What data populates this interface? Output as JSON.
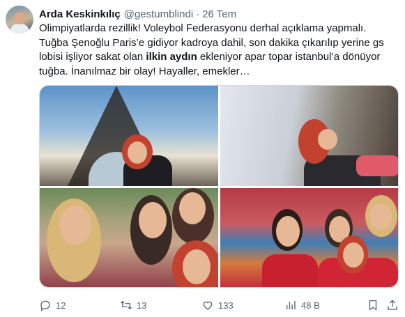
{
  "tweet": {
    "author_name": "Arda Keskinkılıç",
    "handle": "@gestumblindi",
    "separator": "·",
    "time": "26 Tem",
    "text_before": "Olimpiyatlarda rezillik! Voleybol Federasyonu derhal açıklama yapmalı. Tuğba Şenoğlu Paris’e gidiyor kadroya dahil, son dakika çıkarılıp yerine gs lobisi işliyor sakat olan ",
    "text_highlight": "ilkin aydın",
    "text_after": " ekleniyor apar topar istanbul’a dönüyor tuğba. İnanılmaz bir olay! Hayaller, emekler…"
  },
  "actions": {
    "reply_count": "12",
    "retweet_count": "13",
    "like_count": "133",
    "views_count": "48 B"
  },
  "icons": {
    "reply": "reply-icon",
    "retweet": "retweet-icon",
    "like": "heart-icon",
    "views": "views-icon",
    "bookmark": "bookmark-icon",
    "share": "share-icon"
  }
}
